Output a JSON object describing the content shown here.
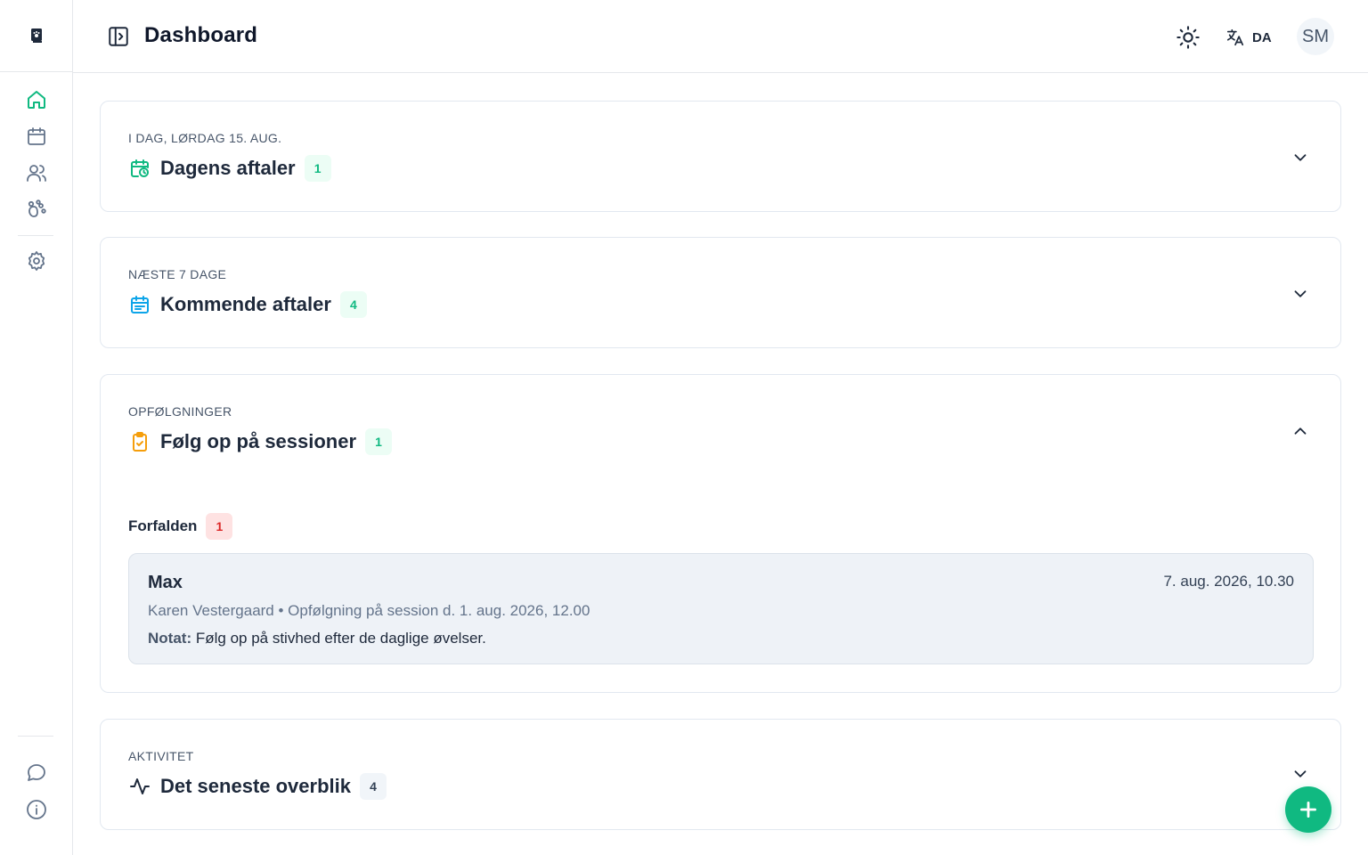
{
  "colors": {
    "accent": "#10b981",
    "text": "#1e293b",
    "muted": "#64748b",
    "border": "#e2e8f0",
    "danger": "#dc2626",
    "calendar_icon": "#0ea5e9",
    "clipboard_icon": "#f59e0b"
  },
  "sidebar": {
    "logo_icon": "paw-book-icon",
    "items": [
      {
        "icon": "home-icon",
        "active": true
      },
      {
        "icon": "calendar-icon"
      },
      {
        "icon": "users-icon"
      },
      {
        "icon": "paw-icon"
      },
      {
        "icon": "gear-icon"
      }
    ],
    "bottom": [
      {
        "icon": "chat-icon"
      },
      {
        "icon": "info-icon"
      }
    ]
  },
  "header": {
    "title": "Dashboard",
    "language": "DA",
    "avatar_initials": "SM"
  },
  "cards": {
    "today": {
      "eyebrow": "I DAG, LØRDAG 15. AUG.",
      "title": "Dagens aftaler",
      "count": "1",
      "expanded": false
    },
    "upcoming": {
      "eyebrow": "NÆSTE 7 DAGE",
      "title": "Kommende aftaler",
      "count": "4",
      "expanded": false
    },
    "followups": {
      "eyebrow": "OPFØLGNINGER",
      "title": "Følg op på sessioner",
      "count": "1",
      "expanded": true,
      "overdue_label": "Forfalden",
      "overdue_count": "1",
      "items": [
        {
          "name": "Max",
          "date": "7. aug. 2026, 10.30",
          "meta": "Karen Vestergaard • Opfølgning på session d. 1. aug. 2026, 12.00",
          "note_label": "Notat:",
          "note_text": "Følg op på stivhed efter de daglige øvelser."
        }
      ]
    },
    "activity": {
      "eyebrow": "AKTIVITET",
      "title": "Det seneste overblik",
      "count": "4",
      "expanded": false
    }
  },
  "fab_icon": "plus-icon"
}
